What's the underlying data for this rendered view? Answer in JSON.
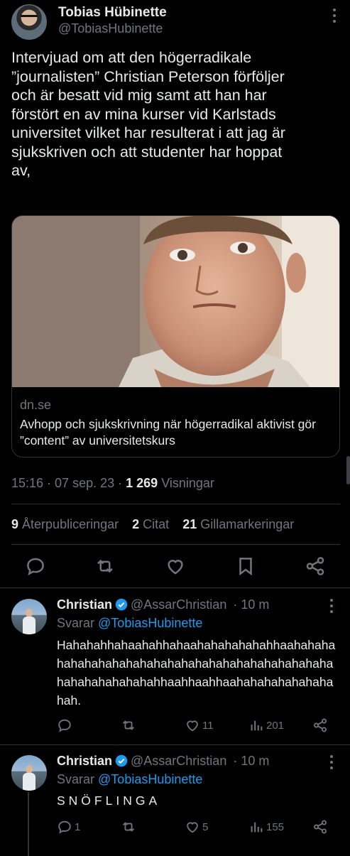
{
  "main_tweet": {
    "author_name": "Tobias Hübinette",
    "author_handle": "@TobiasHubinette",
    "text": "Intervjuad om att den högerradikale\n”journalisten” Christian Peterson förföljer\noch är besatt vid mig samt att han har\nförstört en av mina kurser vid Karlstads\nuniversitet vilket har resulterat i att jag är\nsjukskriven och att studenter har hoppat\nav,",
    "card": {
      "domain": "dn.se",
      "title": "Avhopp och sjukskrivning när högerradikal aktivist gör ”content” av universitetskurs"
    },
    "time": "15:16",
    "date": "07 sep. 23",
    "views_count": "1 269",
    "views_label": "Visningar",
    "stats": {
      "reposts_count": "9",
      "reposts_label": "Återpubliceringar",
      "quotes_count": "2",
      "quotes_label": "Citat",
      "likes_count": "21",
      "likes_label": "Gillamarkeringar"
    }
  },
  "replies": [
    {
      "author_name": "Christian",
      "author_handle": "@AssarChristian",
      "time_ago": "10 m",
      "replying_prefix": "Svarar",
      "replying_to": "@TobiasHubinette",
      "text": "Hahahahhahaahahhahaahahahahahahhaahahahahahahahahahahahahahahahahahahahahahahahahahahahahahahahhaahhaahhaahahahahahahahahah.",
      "comment_count": "",
      "like_count": "11",
      "view_count": "201"
    },
    {
      "author_name": "Christian",
      "author_handle": "@AssarChristian",
      "time_ago": "10 m",
      "replying_prefix": "Svarar",
      "replying_to": "@TobiasHubinette",
      "text": "SNÖFLINGA",
      "comment_count": "1",
      "like_count": "5",
      "view_count": "155"
    }
  ],
  "colors": {
    "background": "#000000",
    "text_primary": "#e7e9ea",
    "text_secondary": "#71767b",
    "accent": "#1d9bf0",
    "border": "#2f3336"
  }
}
